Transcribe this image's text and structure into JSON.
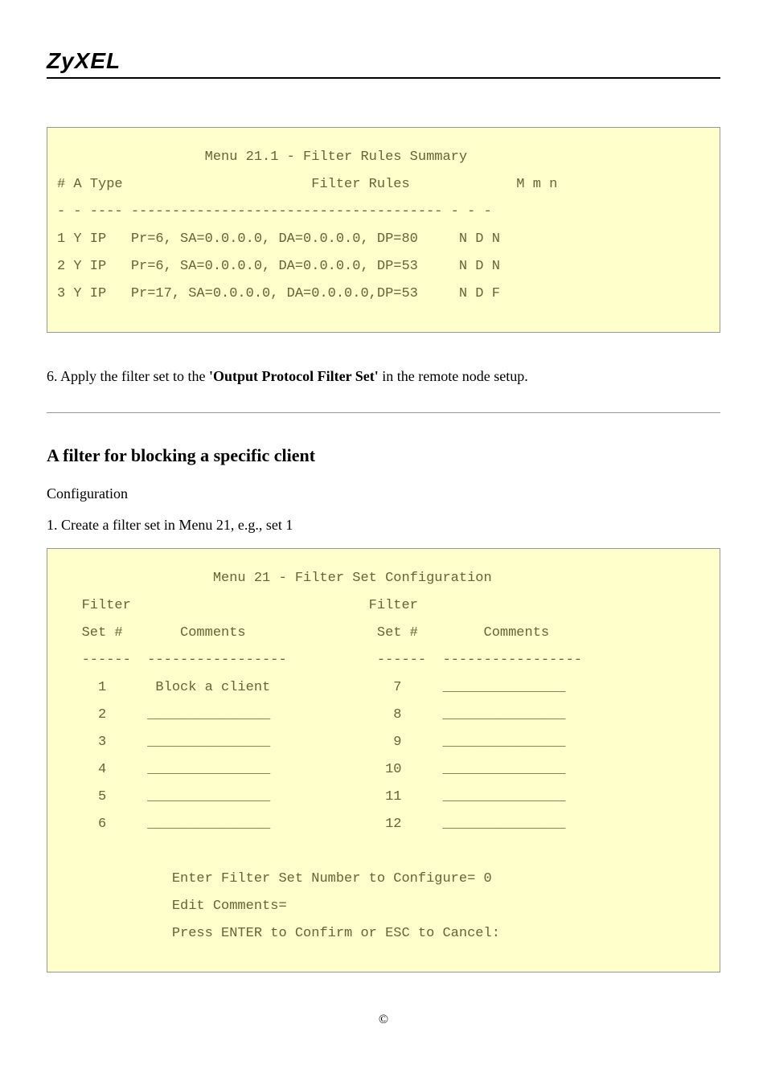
{
  "header": {
    "logo": "ZyXEL"
  },
  "top_box": {
    "title": "                  Menu 21.1 - Filter Rules Summary",
    "hdr": "# A Type                       Filter Rules             M m n",
    "sep": "- - ---- -------------------------------------- - - -",
    "r1": "1 Y IP   Pr=6, SA=0.0.0.0, DA=0.0.0.0, DP=80     N D N",
    "r2": "2 Y IP   Pr=6, SA=0.0.0.0, DA=0.0.0.0, DP=53     N D N",
    "r3": "3 Y IP   Pr=17, SA=0.0.0.0, DA=0.0.0.0,DP=53     N D F"
  },
  "step6_pre": "6. Apply the filter set to the ",
  "step6_bold": "'Output Protocol Filter Set'",
  "step6_post": " in the remote node setup.",
  "section_heading": "A filter for blocking a specific client",
  "config_label": "Configuration",
  "step1": "1. Create a filter set in Menu 21, e.g., set 1",
  "bottom_box": {
    "title": "                   Menu 21 - Filter Set Configuration",
    "hdr1": "   Filter                             Filter",
    "hdr2": "   Set #       Comments                Set #        Comments",
    "sep": "   ------  -----------------           ------  -----------------",
    "r1": "     1      Block a client               7     _______________",
    "r2": "     2     _______________               8     _______________",
    "r3": "     3     _______________               9     _______________",
    "r4": "     4     _______________              10     _______________",
    "r5": "     5     _______________              11     _______________",
    "r6": "     6     _______________              12     _______________",
    "p1": "              Enter Filter Set Number to Configure= 0",
    "p2": "              Edit Comments=",
    "p3": "              Press ENTER to Confirm or ESC to Cancel:"
  },
  "footer": "©"
}
